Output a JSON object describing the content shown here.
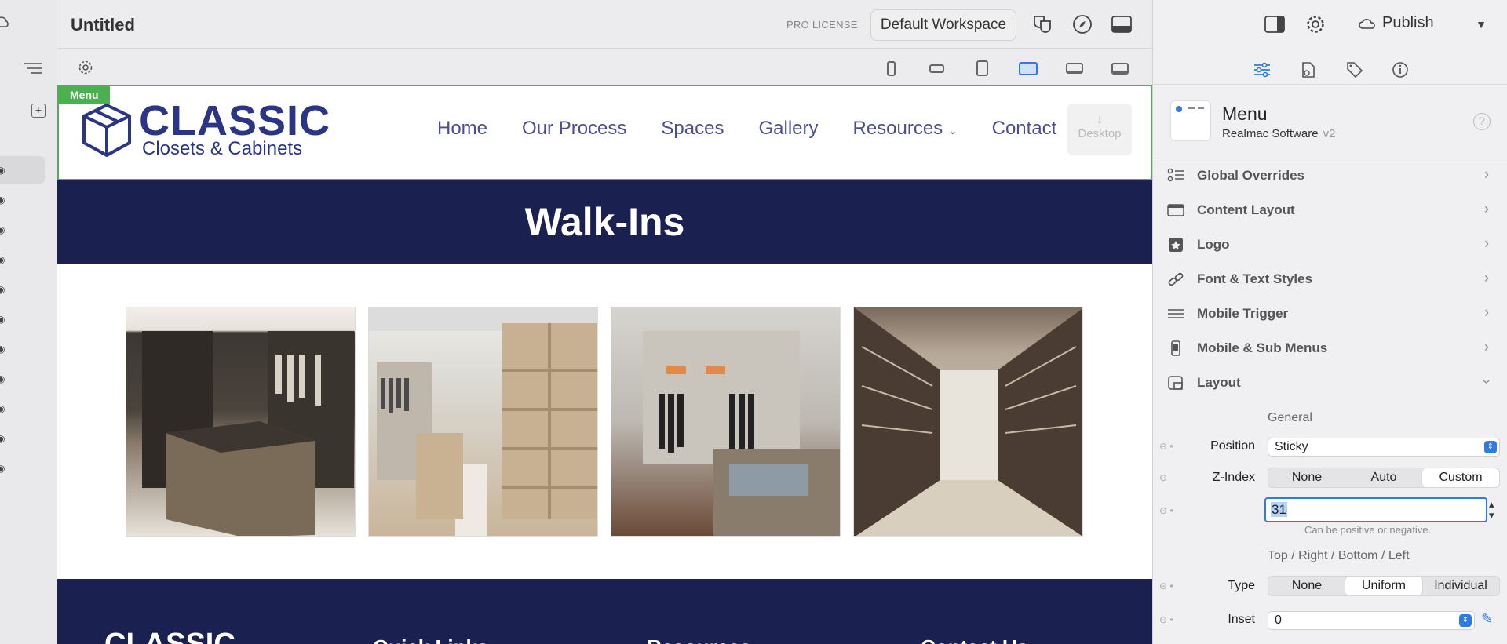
{
  "document": {
    "title": "Untitled"
  },
  "toolbar": {
    "pro_license": "PRO LICENSE",
    "workspace": "Default Workspace"
  },
  "preview": {
    "selection_tag": "Menu",
    "logo": {
      "main": "CLASSIC",
      "sub": "Closets & Cabinets"
    },
    "nav": [
      "Home",
      "Our Process",
      "Spaces",
      "Gallery",
      "Resources",
      "Contact"
    ],
    "breakpoint_badge": "Desktop",
    "hero_title": "Walk-Ins",
    "footer_headings": [
      "Quick Links",
      "Resources",
      "Contact Us"
    ],
    "footer_logo": "CLASSIC"
  },
  "inspector": {
    "publish": "Publish",
    "component": {
      "name": "Menu",
      "vendor": "Realmac Software",
      "version": "v2"
    },
    "sections": [
      {
        "label": "Global Overrides",
        "icon": "overrides-icon"
      },
      {
        "label": "Content Layout",
        "icon": "content-layout-icon"
      },
      {
        "label": "Logo",
        "icon": "logo-star-icon"
      },
      {
        "label": "Font & Text Styles",
        "icon": "link-icon"
      },
      {
        "label": "Mobile Trigger",
        "icon": "hamburger-icon"
      },
      {
        "label": "Mobile & Sub Menus",
        "icon": "phone-icon"
      },
      {
        "label": "Layout",
        "icon": "layout-icon"
      }
    ],
    "layout": {
      "general_title": "General",
      "position_label": "Position",
      "position_value": "Sticky",
      "zindex_label": "Z-Index",
      "zindex_options": [
        "None",
        "Auto",
        "Custom"
      ],
      "zindex_selected": "Custom",
      "zindex_value": "31",
      "zindex_hint": "Can be positive or negative.",
      "trbl_title": "Top / Right / Bottom / Left",
      "type_label": "Type",
      "type_options": [
        "None",
        "Uniform",
        "Individual"
      ],
      "type_selected": "Uniform",
      "inset_label": "Inset",
      "inset_value": "0"
    }
  }
}
